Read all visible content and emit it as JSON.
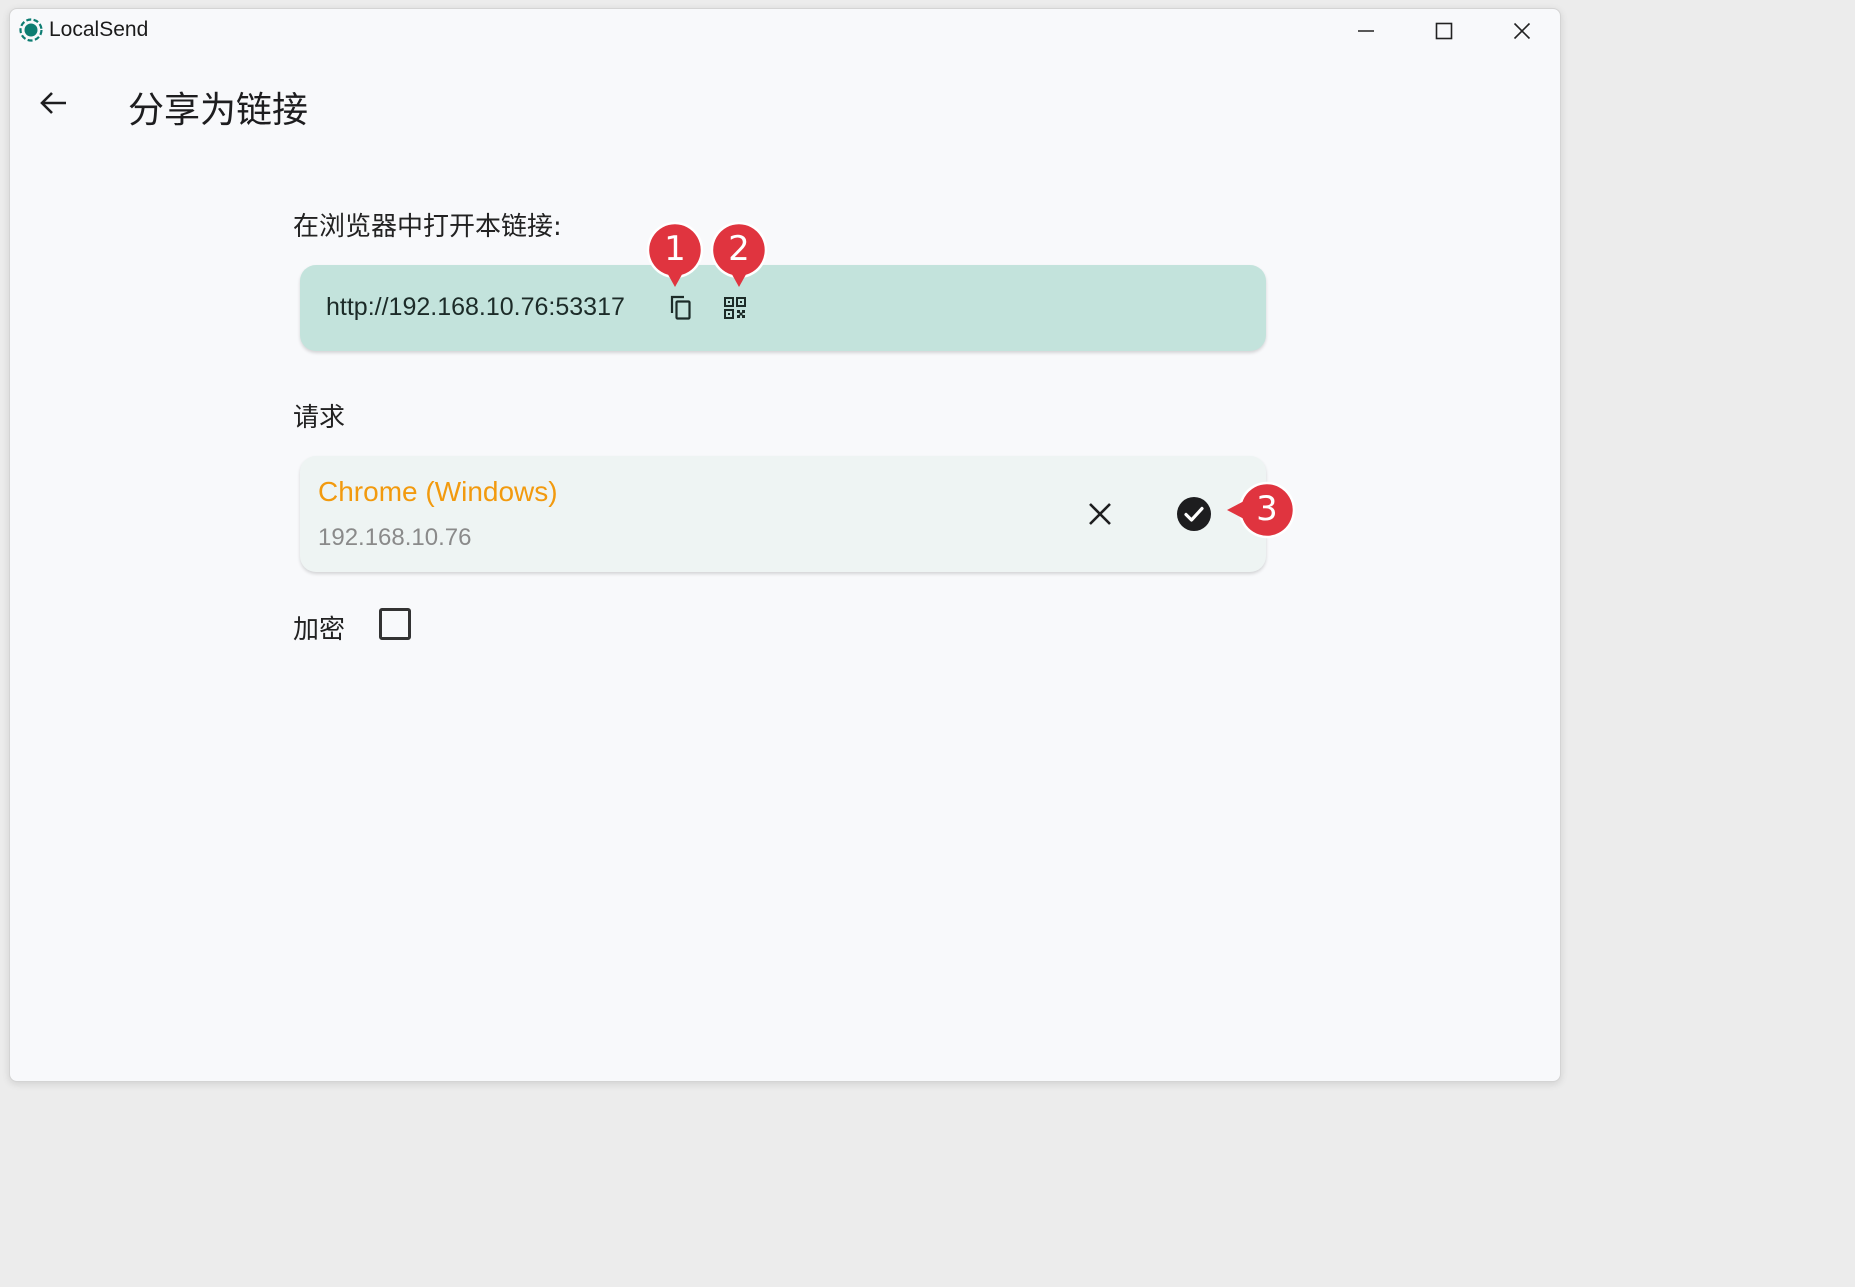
{
  "window": {
    "app_title": "LocalSend",
    "logo_icon": "localsend-logo-icon",
    "controls": [
      "minimize-icon",
      "maximize-icon",
      "close-icon"
    ]
  },
  "header": {
    "back_icon": "arrow-left-icon",
    "title": "分享为链接"
  },
  "link_section": {
    "label": "在浏览器中打开本链接:",
    "url": "http://192.168.10.76:53317",
    "copy_icon": "copy-icon",
    "qr_icon": "qr-code-icon",
    "card_color": "#c3e3dc"
  },
  "requests_section": {
    "label": "请求",
    "items": [
      {
        "name": "Chrome (Windows)",
        "ip": "192.168.10.76",
        "name_color": "#f29a0e",
        "decline_icon": "close-icon",
        "accept_icon": "check-circle-icon"
      }
    ]
  },
  "encryption": {
    "label": "加密",
    "checked": false
  },
  "annotations": {
    "marker_1": "1",
    "marker_2": "2",
    "marker_3": "3",
    "color": "#e0343f"
  }
}
